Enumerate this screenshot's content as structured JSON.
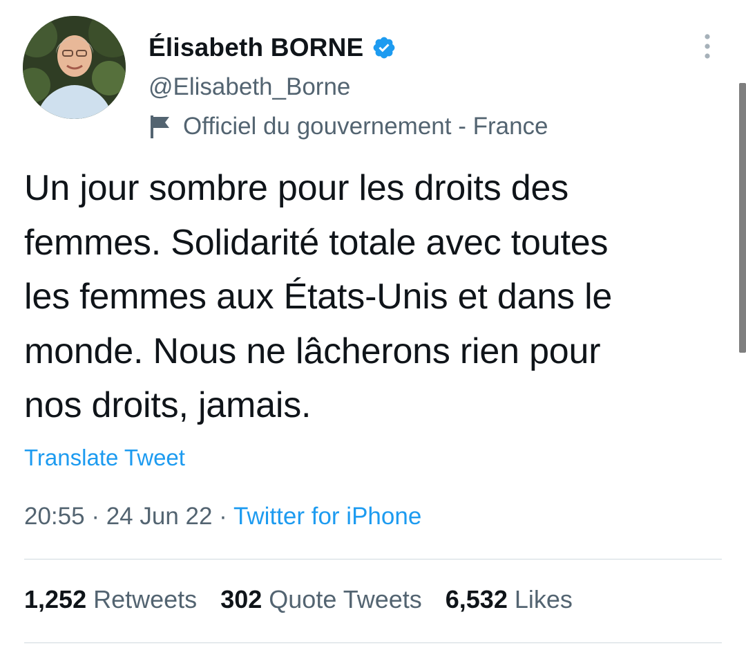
{
  "user": {
    "display_name": "Élisabeth BORNE",
    "handle": "@Elisabeth_Borne",
    "affiliation_label": "Officiel du gouvernement - France",
    "verified_badge_icon": "verified-badge-icon",
    "flag_icon": "government-flag-icon"
  },
  "tweet": {
    "text_lines": [
      "Un jour sombre pour les droits des",
      "femmes. Solidarité totale avec toutes",
      "les femmes aux États-Unis et dans le",
      "monde. Nous ne lâcherons rien pour",
      "nos droits, jamais."
    ],
    "translate_label": "Translate Tweet",
    "time": "20:55",
    "separator": " · ",
    "date": "24 Jun 22",
    "source": "Twitter for iPhone"
  },
  "stats": [
    {
      "count": "1,252",
      "label": "Retweets"
    },
    {
      "count": "302",
      "label": "Quote Tweets"
    },
    {
      "count": "6,532",
      "label": "Likes"
    }
  ],
  "colors": {
    "text": "#0f1419",
    "secondary": "#536471",
    "link": "#1d9bf0",
    "divider": "#cfd9de"
  },
  "menu_icon": "more-vertical-icon"
}
